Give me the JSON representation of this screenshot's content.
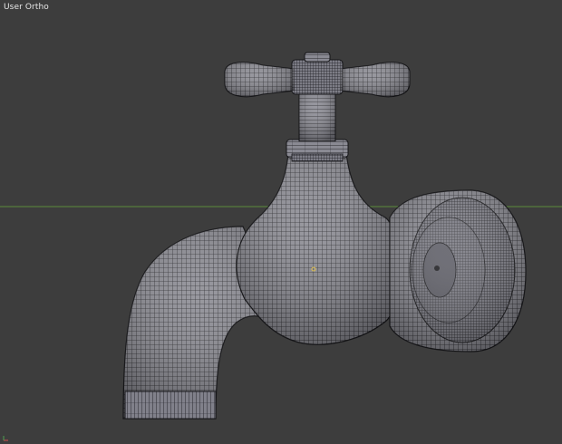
{
  "viewport": {
    "view_label": "User Ortho",
    "background_color": "#3d3d3d",
    "horizon_color": "#5a8a3a",
    "wire_color": "#1e1e22",
    "mesh_color": "#8a8a92",
    "origin_color": "#e0c050"
  },
  "object": {
    "description_icon": "faucet-mesh-icon"
  }
}
